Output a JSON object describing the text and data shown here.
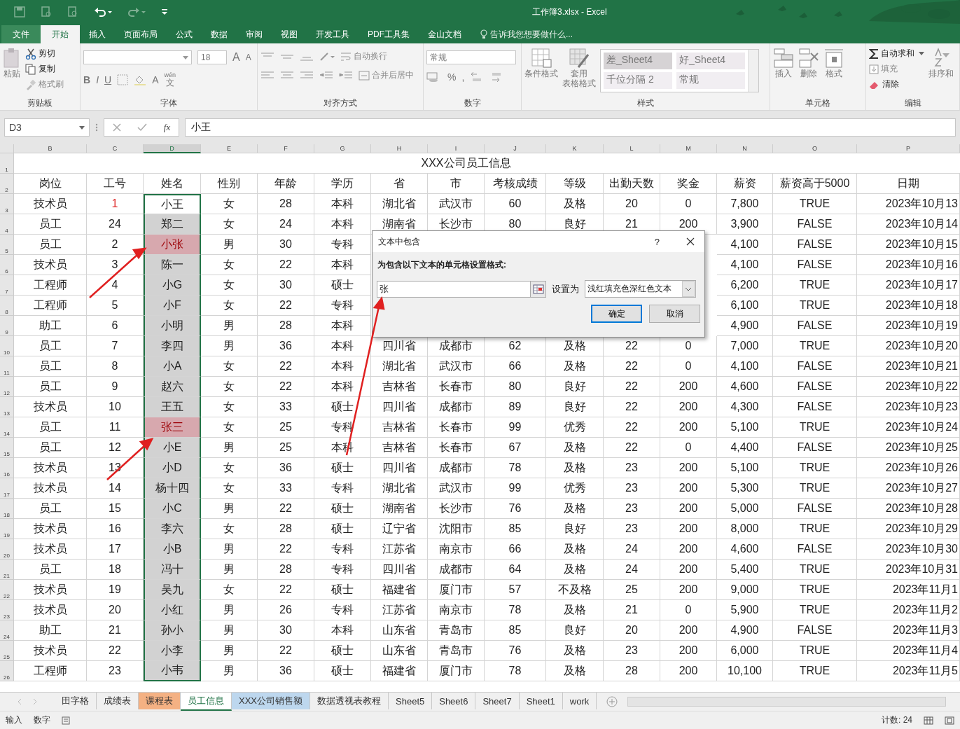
{
  "window": {
    "title": "工作簿3.xlsx - Excel"
  },
  "ribbon_tabs": [
    {
      "label": "文件",
      "selected": false
    },
    {
      "label": "开始",
      "selected": true
    },
    {
      "label": "插入",
      "selected": false
    },
    {
      "label": "页面布局",
      "selected": false
    },
    {
      "label": "公式",
      "selected": false
    },
    {
      "label": "数据",
      "selected": false
    },
    {
      "label": "审阅",
      "selected": false
    },
    {
      "label": "视图",
      "selected": false
    },
    {
      "label": "开发工具",
      "selected": false
    },
    {
      "label": "PDF工具集",
      "selected": false
    },
    {
      "label": "金山文档",
      "selected": false
    }
  ],
  "tell_me": "告诉我您想要做什么...",
  "ribbon": {
    "clipboard": {
      "label": "剪贴板",
      "paste": "粘贴",
      "cut": "剪切",
      "copy": "复制",
      "format_painter": "格式刷"
    },
    "font": {
      "label": "字体",
      "font_size": "18",
      "bold": "B",
      "italic": "I",
      "underline": "U",
      "grow": "A",
      "shrink": "A",
      "font_color": "A",
      "phonetic_top": "wén",
      "phonetic_bottom": "文"
    },
    "alignment": {
      "label": "对齐方式",
      "wrap_text": "自动换行",
      "merge_center": "合并后居中"
    },
    "number": {
      "label": "数字",
      "format": "常规",
      "percent": "%",
      "comma": ","
    },
    "styles": {
      "label": "样式",
      "conditional": "条件格式",
      "table_line1": "套用",
      "table_line2": "表格格式",
      "gallery": [
        {
          "label": "差_Sheet4",
          "kind": "bad"
        },
        {
          "label": "好_Sheet4",
          "kind": "good"
        },
        {
          "label": "千位分隔 2",
          "kind": "normal"
        },
        {
          "label": "常规",
          "kind": "normal"
        }
      ]
    },
    "cells": {
      "label": "单元格",
      "insert": "插入",
      "delete": "删除",
      "format": "格式"
    },
    "editing": {
      "label": "编辑",
      "autosum": "自动求和",
      "fill": "填充",
      "clear": "清除",
      "sort": "排序和"
    }
  },
  "formula_bar": {
    "name_box": "D3",
    "function_label": "fx",
    "value": "小王"
  },
  "sheet": {
    "columns": [
      {
        "letter": "B",
        "selected": false
      },
      {
        "letter": "C",
        "selected": false
      },
      {
        "letter": "D",
        "selected": true
      },
      {
        "letter": "E",
        "selected": false
      },
      {
        "letter": "F",
        "selected": false
      },
      {
        "letter": "G",
        "selected": false
      },
      {
        "letter": "H",
        "selected": false
      },
      {
        "letter": "I",
        "selected": false
      },
      {
        "letter": "J",
        "selected": false
      },
      {
        "letter": "K",
        "selected": false
      },
      {
        "letter": "L",
        "selected": false
      },
      {
        "letter": "M",
        "selected": false
      },
      {
        "letter": "N",
        "selected": false
      },
      {
        "letter": "O",
        "selected": false
      },
      {
        "letter": "P",
        "selected": false
      }
    ],
    "title_row": "1",
    "title": "XXX公司员工信息",
    "header_row": "2",
    "headers": [
      "岗位",
      "工号",
      "姓名",
      "性别",
      "年龄",
      "学历",
      "省",
      "市",
      "考核成绩",
      "等级",
      "出勤天数",
      "奖金",
      "薪资",
      "薪资高于5000",
      "日期"
    ],
    "rows": [
      {
        "row_number": "3",
        "id_marked": true,
        "name_highlight": false,
        "cells": [
          "技术员",
          "1",
          "小王",
          "女",
          "28",
          "本科",
          "湖北省",
          "武汉市",
          "60",
          "及格",
          "20",
          "0",
          "7,800",
          "TRUE",
          "2023年10月13"
        ]
      },
      {
        "row_number": "4",
        "id_marked": false,
        "name_highlight": false,
        "cells": [
          "员工",
          "24",
          "郑二",
          "女",
          "24",
          "本科",
          "湖南省",
          "长沙市",
          "80",
          "良好",
          "21",
          "200",
          "3,900",
          "FALSE",
          "2023年10月14"
        ]
      },
      {
        "row_number": "5",
        "id_marked": false,
        "name_highlight": true,
        "cells": [
          "员工",
          "2",
          "小张",
          "男",
          "30",
          "专科",
          null,
          null,
          null,
          null,
          null,
          null,
          "4,100",
          "FALSE",
          "2023年10月15"
        ]
      },
      {
        "row_number": "6",
        "id_marked": false,
        "name_highlight": false,
        "cells": [
          "技术员",
          "3",
          "陈一",
          "女",
          "22",
          "本科",
          null,
          null,
          null,
          null,
          null,
          null,
          "4,100",
          "FALSE",
          "2023年10月16"
        ]
      },
      {
        "row_number": "7",
        "id_marked": false,
        "name_highlight": false,
        "cells": [
          "工程师",
          "4",
          "小G",
          "女",
          "30",
          "硕士",
          null,
          null,
          null,
          null,
          null,
          null,
          "6,200",
          "TRUE",
          "2023年10月17"
        ]
      },
      {
        "row_number": "8",
        "id_marked": false,
        "name_highlight": false,
        "cells": [
          "工程师",
          "5",
          "小F",
          "女",
          "22",
          "专科",
          null,
          null,
          null,
          null,
          null,
          null,
          "6,100",
          "TRUE",
          "2023年10月18"
        ]
      },
      {
        "row_number": "9",
        "id_marked": false,
        "name_highlight": false,
        "cells": [
          "助工",
          "6",
          "小明",
          "男",
          "28",
          "本科",
          null,
          null,
          null,
          null,
          null,
          null,
          "4,900",
          "FALSE",
          "2023年10月19"
        ]
      },
      {
        "row_number": "10",
        "id_marked": false,
        "name_highlight": false,
        "cells": [
          "员工",
          "7",
          "李四",
          "男",
          "36",
          "本科",
          "四川省",
          "成都市",
          "62",
          "及格",
          "22",
          "0",
          "7,000",
          "TRUE",
          "2023年10月20"
        ]
      },
      {
        "row_number": "11",
        "id_marked": false,
        "name_highlight": false,
        "cells": [
          "员工",
          "8",
          "小A",
          "女",
          "22",
          "本科",
          "湖北省",
          "武汉市",
          "66",
          "及格",
          "22",
          "0",
          "4,100",
          "FALSE",
          "2023年10月21"
        ]
      },
      {
        "row_number": "12",
        "id_marked": false,
        "name_highlight": false,
        "cells": [
          "员工",
          "9",
          "赵六",
          "女",
          "22",
          "本科",
          "吉林省",
          "长春市",
          "80",
          "良好",
          "22",
          "200",
          "4,600",
          "FALSE",
          "2023年10月22"
        ]
      },
      {
        "row_number": "13",
        "id_marked": false,
        "name_highlight": false,
        "cells": [
          "技术员",
          "10",
          "王五",
          "女",
          "33",
          "硕士",
          "四川省",
          "成都市",
          "89",
          "良好",
          "22",
          "200",
          "4,300",
          "FALSE",
          "2023年10月23"
        ]
      },
      {
        "row_number": "14",
        "id_marked": false,
        "name_highlight": true,
        "cells": [
          "员工",
          "11",
          "张三",
          "女",
          "25",
          "专科",
          "吉林省",
          "长春市",
          "99",
          "优秀",
          "22",
          "200",
          "5,100",
          "TRUE",
          "2023年10月24"
        ]
      },
      {
        "row_number": "15",
        "id_marked": false,
        "name_highlight": false,
        "cells": [
          "员工",
          "12",
          "小E",
          "男",
          "25",
          "本科",
          "吉林省",
          "长春市",
          "67",
          "及格",
          "22",
          "0",
          "4,400",
          "FALSE",
          "2023年10月25"
        ]
      },
      {
        "row_number": "16",
        "id_marked": false,
        "name_highlight": false,
        "cells": [
          "技术员",
          "13",
          "小D",
          "女",
          "36",
          "硕士",
          "四川省",
          "成都市",
          "78",
          "及格",
          "23",
          "200",
          "5,100",
          "TRUE",
          "2023年10月26"
        ]
      },
      {
        "row_number": "17",
        "id_marked": false,
        "name_highlight": false,
        "cells": [
          "技术员",
          "14",
          "杨十四",
          "女",
          "33",
          "专科",
          "湖北省",
          "武汉市",
          "99",
          "优秀",
          "23",
          "200",
          "5,300",
          "TRUE",
          "2023年10月27"
        ]
      },
      {
        "row_number": "18",
        "id_marked": false,
        "name_highlight": false,
        "cells": [
          "员工",
          "15",
          "小C",
          "男",
          "22",
          "硕士",
          "湖南省",
          "长沙市",
          "76",
          "及格",
          "23",
          "200",
          "5,000",
          "FALSE",
          "2023年10月28"
        ]
      },
      {
        "row_number": "19",
        "id_marked": false,
        "name_highlight": false,
        "cells": [
          "技术员",
          "16",
          "李六",
          "女",
          "28",
          "硕士",
          "辽宁省",
          "沈阳市",
          "85",
          "良好",
          "23",
          "200",
          "8,000",
          "TRUE",
          "2023年10月29"
        ]
      },
      {
        "row_number": "20",
        "id_marked": false,
        "name_highlight": false,
        "cells": [
          "技术员",
          "17",
          "小B",
          "男",
          "22",
          "专科",
          "江苏省",
          "南京市",
          "66",
          "及格",
          "24",
          "200",
          "4,600",
          "FALSE",
          "2023年10月30"
        ]
      },
      {
        "row_number": "21",
        "id_marked": false,
        "name_highlight": false,
        "cells": [
          "员工",
          "18",
          "冯十",
          "男",
          "28",
          "专科",
          "四川省",
          "成都市",
          "64",
          "及格",
          "24",
          "200",
          "5,400",
          "TRUE",
          "2023年10月31"
        ]
      },
      {
        "row_number": "22",
        "id_marked": false,
        "name_highlight": false,
        "cells": [
          "技术员",
          "19",
          "吴九",
          "女",
          "22",
          "硕士",
          "福建省",
          "厦门市",
          "57",
          "不及格",
          "25",
          "200",
          "9,000",
          "TRUE",
          "2023年11月1"
        ]
      },
      {
        "row_number": "23",
        "id_marked": false,
        "name_highlight": false,
        "cells": [
          "技术员",
          "20",
          "小红",
          "男",
          "26",
          "专科",
          "江苏省",
          "南京市",
          "78",
          "及格",
          "21",
          "0",
          "5,900",
          "TRUE",
          "2023年11月2"
        ]
      },
      {
        "row_number": "24",
        "id_marked": false,
        "name_highlight": false,
        "cells": [
          "助工",
          "21",
          "孙小",
          "男",
          "30",
          "本科",
          "山东省",
          "青岛市",
          "85",
          "良好",
          "20",
          "200",
          "4,900",
          "FALSE",
          "2023年11月3"
        ]
      },
      {
        "row_number": "25",
        "id_marked": false,
        "name_highlight": false,
        "cells": [
          "技术员",
          "22",
          "小李",
          "男",
          "22",
          "硕士",
          "山东省",
          "青岛市",
          "76",
          "及格",
          "23",
          "200",
          "6,000",
          "TRUE",
          "2023年11月4"
        ]
      },
      {
        "row_number": "26",
        "id_marked": false,
        "name_highlight": false,
        "cells": [
          "工程师",
          "23",
          "小韦",
          "男",
          "36",
          "硕士",
          "福建省",
          "厦门市",
          "78",
          "及格",
          "28",
          "200",
          "10,100",
          "TRUE",
          "2023年11月5"
        ]
      }
    ]
  },
  "dialog": {
    "title": "文本中包含",
    "help": "?",
    "prompt": "为包含以下文本的单元格设置格式:",
    "value": "张",
    "set_as": "设置为",
    "format": "浅红填充色深红色文本",
    "ok": "确定",
    "cancel": "取消"
  },
  "sheet_tabs": [
    {
      "label": "田字格",
      "selected": false
    },
    {
      "label": "成绩表",
      "selected": false
    },
    {
      "label": "课程表",
      "selected": false,
      "color": "#f4b183"
    },
    {
      "label": "员工信息",
      "selected": true
    },
    {
      "label": "XXX公司销售额",
      "selected": false,
      "color": "#bdd7ee"
    },
    {
      "label": "数据透视表教程",
      "selected": false
    },
    {
      "label": "Sheet5",
      "selected": false
    },
    {
      "label": "Sheet6",
      "selected": false
    },
    {
      "label": "Sheet7",
      "selected": false
    },
    {
      "label": "Sheet1",
      "selected": false
    },
    {
      "label": "work",
      "selected": false
    }
  ],
  "status_bar": {
    "mode": "输入",
    "num_lock": "数字",
    "count": "计数: 24"
  }
}
